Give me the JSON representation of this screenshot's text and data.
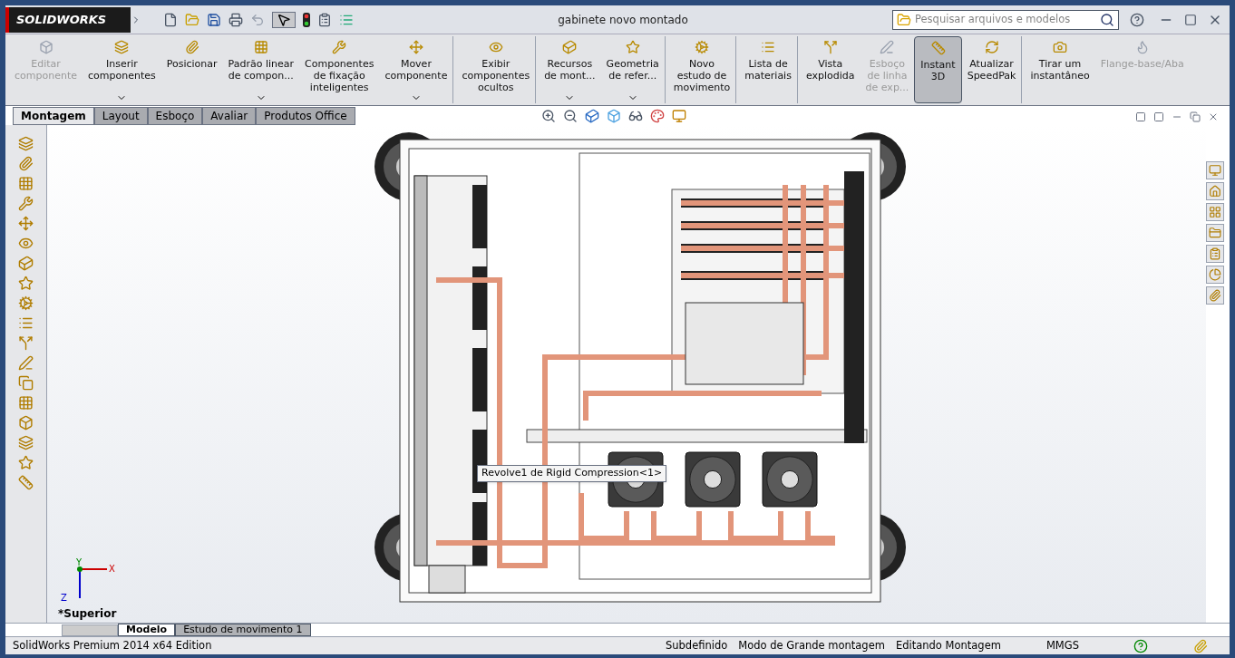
{
  "app": {
    "logo": "SOLIDWORKS"
  },
  "window": {
    "title": "gabinete novo montado"
  },
  "search": {
    "placeholder": "Pesquisar arquivos e modelos"
  },
  "ribbon": [
    {
      "lines": [
        "Editar",
        "componente"
      ],
      "disabled": true,
      "dropdown": false,
      "selected": false,
      "separator_after": false
    },
    {
      "lines": [
        "Inserir",
        "componentes"
      ],
      "disabled": false,
      "dropdown": true,
      "selected": false,
      "separator_after": false
    },
    {
      "lines": [
        "Posicionar"
      ],
      "disabled": false,
      "dropdown": false,
      "selected": false,
      "separator_after": false
    },
    {
      "lines": [
        "Padrão linear",
        "de compon..."
      ],
      "disabled": false,
      "dropdown": true,
      "selected": false,
      "separator_after": false
    },
    {
      "lines": [
        "Componentes",
        "de fixação",
        "inteligentes"
      ],
      "disabled": false,
      "dropdown": false,
      "selected": false,
      "separator_after": false
    },
    {
      "lines": [
        "Mover",
        "componente"
      ],
      "disabled": false,
      "dropdown": true,
      "selected": false,
      "separator_after": true
    },
    {
      "lines": [
        "Exibir",
        "componentes",
        "ocultos"
      ],
      "disabled": false,
      "dropdown": false,
      "selected": false,
      "separator_after": true
    },
    {
      "lines": [
        "Recursos",
        "de mont..."
      ],
      "disabled": false,
      "dropdown": true,
      "selected": false,
      "separator_after": false
    },
    {
      "lines": [
        "Geometria",
        "de refer..."
      ],
      "disabled": false,
      "dropdown": true,
      "selected": false,
      "separator_after": true
    },
    {
      "lines": [
        "Novo",
        "estudo de",
        "movimento"
      ],
      "disabled": false,
      "dropdown": false,
      "selected": false,
      "separator_after": true
    },
    {
      "lines": [
        "Lista de",
        "materiais"
      ],
      "disabled": false,
      "dropdown": false,
      "selected": false,
      "separator_after": true
    },
    {
      "lines": [
        "Vista",
        "explodida"
      ],
      "disabled": false,
      "dropdown": false,
      "selected": false,
      "separator_after": false
    },
    {
      "lines": [
        "Esboço",
        "de linha",
        "de exp..."
      ],
      "disabled": true,
      "dropdown": false,
      "selected": false,
      "separator_after": false
    },
    {
      "lines": [
        "Instant",
        "3D"
      ],
      "disabled": false,
      "dropdown": false,
      "selected": true,
      "separator_after": false
    },
    {
      "lines": [
        "Atualizar",
        "SpeedPak"
      ],
      "disabled": false,
      "dropdown": false,
      "selected": false,
      "separator_after": true
    },
    {
      "lines": [
        "Tirar um",
        "instantâneo"
      ],
      "disabled": false,
      "dropdown": false,
      "selected": false,
      "separator_after": false
    },
    {
      "lines": [
        "Flange-base/Aba"
      ],
      "disabled": true,
      "dropdown": false,
      "selected": false,
      "separator_after": false
    }
  ],
  "tabs": [
    {
      "label": "Montagem",
      "selected": true
    },
    {
      "label": "Layout",
      "selected": false
    },
    {
      "label": "Esboço",
      "selected": false
    },
    {
      "label": "Avaliar",
      "selected": false
    },
    {
      "label": "Produtos Office",
      "selected": false
    }
  ],
  "viewport": {
    "tooltip": "Revolve1 de Rigid Compression<1>",
    "view_label": "*Superior",
    "axis_x": "X",
    "axis_y": "Y",
    "axis_z": "Z"
  },
  "bottom_tabs": [
    {
      "label": "Modelo",
      "selected": true
    },
    {
      "label": "Estudo de movimento 1",
      "selected": false
    }
  ],
  "status_bar": {
    "edition": "SolidWorks Premium 2014 x64 Edition",
    "items": [
      "Subdefinido",
      "Modo de Grande montagem",
      "Editando Montagem"
    ],
    "units": "MMGS"
  }
}
